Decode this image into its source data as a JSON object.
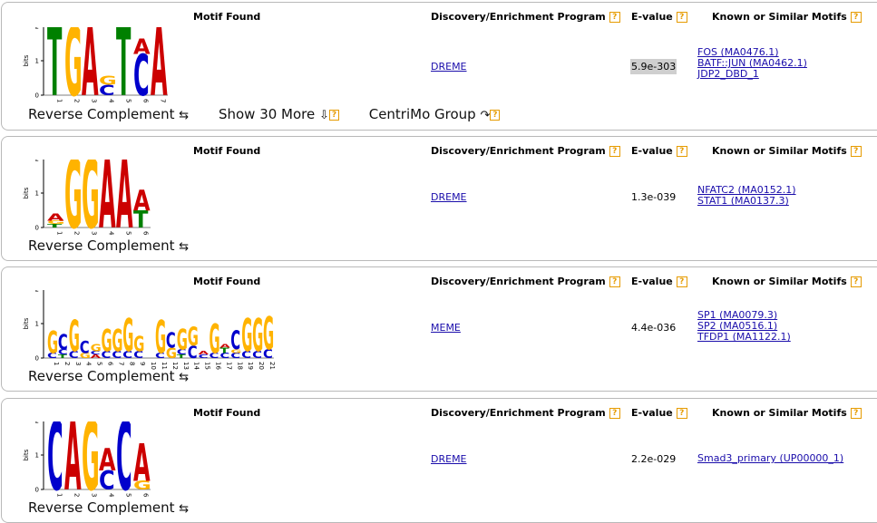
{
  "headers": {
    "motif_found": "Motif Found",
    "program": "Discovery/Enrichment Program",
    "evalue": "E-value",
    "known": "Known or Similar Motifs",
    "help_glyph": "?"
  },
  "axis": {
    "ylabel": "bits",
    "ticks": [
      "2",
      "1",
      "0"
    ]
  },
  "actions": {
    "reverse_complement": "Reverse Complement",
    "reverse_complement_icon": "⇆",
    "show_more": "Show 30 More",
    "show_more_icon": "⇩",
    "centrimo": "CentriMo Group",
    "centrimo_icon": "↷"
  },
  "colors": {
    "A": "#cc0000",
    "C": "#0000cc",
    "G": "#ffb300",
    "T": "#008000",
    "link": "#1a0dab",
    "help": "#e69b00",
    "evalue_highlight": "#cfcfcf"
  },
  "motifs": [
    {
      "program": "DREME",
      "evalue": "5.9e-303",
      "evalue_highlighted": true,
      "known": [
        "FOS (MA0476.1)",
        "BATF::JUN (MA0462.1)",
        "JDP2_DBD_1"
      ],
      "show_more": true,
      "positions": [
        [
          {
            "l": "T",
            "h": 2.0
          }
        ],
        [
          {
            "l": "G",
            "h": 2.0
          }
        ],
        [
          {
            "l": "A",
            "h": 2.0
          }
        ],
        [
          {
            "l": "C",
            "h": 0.3
          },
          {
            "l": "G",
            "h": 0.25
          }
        ],
        [
          {
            "l": "T",
            "h": 2.0
          }
        ],
        [
          {
            "l": "C",
            "h": 1.2
          },
          {
            "l": "A",
            "h": 0.45
          }
        ],
        [
          {
            "l": "A",
            "h": 2.0
          }
        ]
      ]
    },
    {
      "program": "DREME",
      "evalue": "1.3e-039",
      "evalue_highlighted": false,
      "known": [
        "NFATC2 (MA0152.1)",
        "STAT1 (MA0137.3)"
      ],
      "show_more": false,
      "positions": [
        [
          {
            "l": "T",
            "h": 0.1
          },
          {
            "l": "G",
            "h": 0.1
          },
          {
            "l": "A",
            "h": 0.2
          }
        ],
        [
          {
            "l": "G",
            "h": 2.0
          }
        ],
        [
          {
            "l": "G",
            "h": 2.0
          }
        ],
        [
          {
            "l": "A",
            "h": 2.0
          }
        ],
        [
          {
            "l": "A",
            "h": 2.0
          }
        ],
        [
          {
            "l": "T",
            "h": 0.5
          },
          {
            "l": "A",
            "h": 0.6
          }
        ]
      ]
    },
    {
      "program": "MEME",
      "evalue": "4.4e-036",
      "evalue_highlighted": false,
      "known": [
        "SP1 (MA0079.3)",
        "SP2 (MA0516.1)",
        "TFDP1 (MA1122.1)"
      ],
      "show_more": false,
      "positions": [
        [
          {
            "l": "C",
            "h": 0.15
          },
          {
            "l": "G",
            "h": 0.65
          }
        ],
        [
          {
            "l": "T",
            "h": 0.1
          },
          {
            "l": "C",
            "h": 0.15
          },
          {
            "l": "C",
            "h": 0.45
          }
        ],
        [
          {
            "l": "C",
            "h": 0.2
          },
          {
            "l": "G",
            "h": 0.9
          }
        ],
        [
          {
            "l": "G",
            "h": 0.15
          },
          {
            "l": "C",
            "h": 0.35
          }
        ],
        [
          {
            "l": "A",
            "h": 0.1
          },
          {
            "l": "C",
            "h": 0.1
          },
          {
            "l": "G",
            "h": 0.2
          }
        ],
        [
          {
            "l": "C",
            "h": 0.2
          },
          {
            "l": "G",
            "h": 0.65
          }
        ],
        [
          {
            "l": "C",
            "h": 0.2
          },
          {
            "l": "G",
            "h": 0.65
          }
        ],
        [
          {
            "l": "C",
            "h": 0.2
          },
          {
            "l": "G",
            "h": 0.95
          }
        ],
        [
          {
            "l": "C",
            "h": 0.2
          },
          {
            "l": "G",
            "h": 0.45
          }
        ],
        [],
        [
          {
            "l": "C",
            "h": 0.15
          },
          {
            "l": "G",
            "h": 0.95
          }
        ],
        [
          {
            "l": "G",
            "h": 0.3
          },
          {
            "l": "C",
            "h": 0.45
          }
        ],
        [
          {
            "l": "T",
            "h": 0.1
          },
          {
            "l": "C",
            "h": 0.15
          },
          {
            "l": "G",
            "h": 0.6
          }
        ],
        [
          {
            "l": "C",
            "h": 0.35
          },
          {
            "l": "G",
            "h": 0.55
          }
        ],
        [
          {
            "l": "C",
            "h": 0.1
          },
          {
            "l": "A",
            "h": 0.1
          }
        ],
        [
          {
            "l": "C",
            "h": 0.15
          },
          {
            "l": "G",
            "h": 0.85
          }
        ],
        [
          {
            "l": "C",
            "h": 0.15
          },
          {
            "l": "T",
            "h": 0.15
          },
          {
            "l": "A",
            "h": 0.1
          }
        ],
        [
          {
            "l": "C",
            "h": 0.15
          },
          {
            "l": "G",
            "h": 0.1
          },
          {
            "l": "C",
            "h": 0.55
          }
        ],
        [
          {
            "l": "C",
            "h": 0.2
          },
          {
            "l": "G",
            "h": 0.95
          }
        ],
        [
          {
            "l": "C",
            "h": 0.2
          },
          {
            "l": "G",
            "h": 0.95
          }
        ],
        [
          {
            "l": "C",
            "h": 0.25
          },
          {
            "l": "G",
            "h": 0.95
          }
        ]
      ]
    },
    {
      "program": "DREME",
      "evalue": "2.2e-029",
      "evalue_highlighted": false,
      "known": [
        "Smad3_primary (UP00000_1)"
      ],
      "show_more": false,
      "positions": [
        [
          {
            "l": "C",
            "h": 2.0
          }
        ],
        [
          {
            "l": "A",
            "h": 2.0
          }
        ],
        [
          {
            "l": "G",
            "h": 2.0
          }
        ],
        [
          {
            "l": "C",
            "h": 0.55
          },
          {
            "l": "A",
            "h": 0.65
          }
        ],
        [
          {
            "l": "C",
            "h": 2.0
          }
        ],
        [
          {
            "l": "G",
            "h": 0.25
          },
          {
            "l": "A",
            "h": 1.1
          }
        ]
      ]
    }
  ]
}
